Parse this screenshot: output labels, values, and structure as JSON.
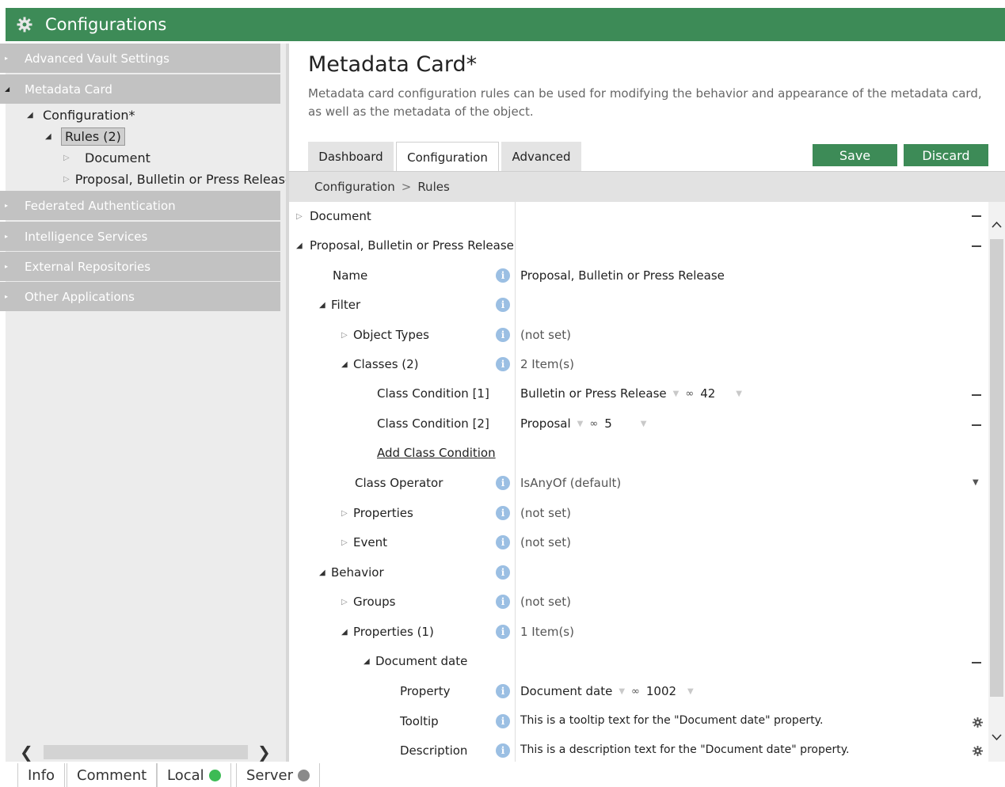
{
  "titlebar": {
    "title": "Configurations",
    "icon": "gear-icon"
  },
  "sidebar": {
    "sections": [
      {
        "label": "Advanced Vault Settings"
      },
      {
        "label": "Metadata Card"
      },
      {
        "label": "Federated Authentication"
      },
      {
        "label": "Intelligence Services"
      },
      {
        "label": "External Repositories"
      },
      {
        "label": "Other Applications"
      }
    ],
    "tree": {
      "configuration": "Configuration*",
      "rules": "Rules (2)",
      "document": "Document",
      "proposal": "Proposal, Bulletin or Press Release"
    }
  },
  "main": {
    "title": "Metadata Card*",
    "description": "Metadata card configuration rules can be used for modifying the behavior and appearance of the metadata card, as well as the metadata of the object.",
    "tabs": [
      "Dashboard",
      "Configuration",
      "Advanced"
    ],
    "active_tab": "Configuration",
    "save_label": "Save",
    "discard_label": "Discard",
    "breadcrumb": [
      "Configuration",
      "Rules"
    ],
    "breadcrumb_separator": ">"
  },
  "rows": {
    "document": "Document",
    "proposal": "Proposal, Bulletin or Press Release",
    "name_label": "Name",
    "name_value": "Proposal, Bulletin or Press Release",
    "filter": "Filter",
    "object_types": "Object Types",
    "object_types_value": "(not set)",
    "classes": "Classes (2)",
    "classes_value": "2 Item(s)",
    "class_cond_1": "Class Condition [1]",
    "class_cond_1_value": "Bulletin or Press Release",
    "class_cond_1_id": "42",
    "class_cond_2": "Class Condition [2]",
    "class_cond_2_value": "Proposal",
    "class_cond_2_id": "5",
    "add_class_condition": "Add Class Condition",
    "class_operator": "Class Operator",
    "class_operator_value": "IsAnyOf (default)",
    "properties": "Properties",
    "properties_value": "(not set)",
    "event": "Event",
    "event_value": "(not set)",
    "behavior": "Behavior",
    "groups": "Groups",
    "groups_value": "(not set)",
    "behavior_properties": "Properties (1)",
    "behavior_properties_value": "1 Item(s)",
    "document_date": "Document date",
    "property_label": "Property",
    "property_value": "Document date",
    "property_id": "1002",
    "tooltip_label": "Tooltip",
    "tooltip_value": "This is a tooltip text for the \"Document date\" property.",
    "description_label": "Description",
    "description_value": "This is a description text for the \"Document date\" property."
  },
  "statusbar": {
    "info": "Info",
    "comment": "Comment",
    "local": "Local",
    "local_color": "#3dbb55",
    "server": "Server",
    "server_color": "#8a8a8a"
  },
  "colors": {
    "accent": "#3d8b57",
    "sidebar_section": "#c2c2c2",
    "info_icon": "#9bbfe3"
  }
}
